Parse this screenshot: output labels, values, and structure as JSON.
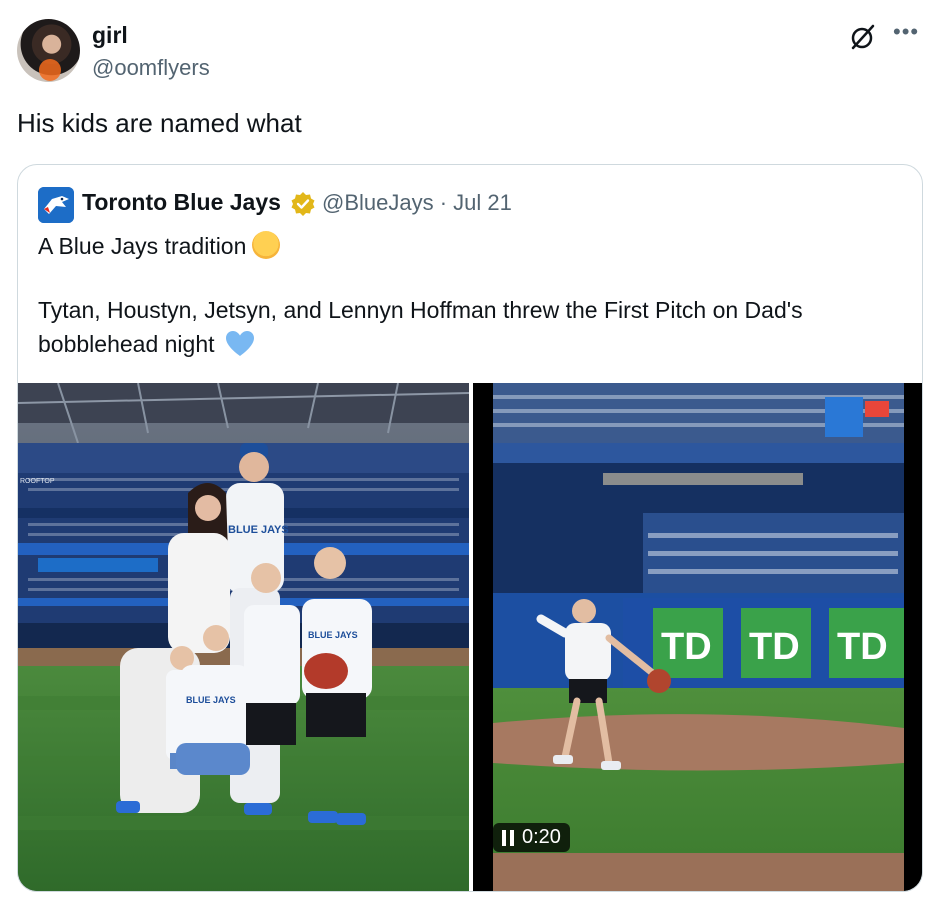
{
  "tweet": {
    "author_name": "girl",
    "author_handle": "@oomflyers",
    "text": "His kids are named what"
  },
  "quote": {
    "author_name": "Toronto Blue Jays",
    "author_handle": "@BlueJays",
    "date": "Jul 21",
    "meta": "@BlueJays · Jul 21",
    "line1": "A Blue Jays tradition",
    "body": "Tytan, Houstyn, Jetsyn, and Lennyn Hoffman threw the First Pitch on Dad's bobblehead night",
    "emoji_1": "hugging-face",
    "emoji_2": "blue-heart"
  },
  "media": {
    "video_time": "0:20",
    "jersey_text": "BLUE JAYS",
    "sign_text": "TD",
    "stadium_sign": "ROOFTOP"
  },
  "colors": {
    "handle_gray": "#536471",
    "border": "#cfd9de",
    "blue_jays_blue": "#1d6dc7",
    "verified_gold": "#e2b719",
    "td_green": "#3aa24a"
  }
}
